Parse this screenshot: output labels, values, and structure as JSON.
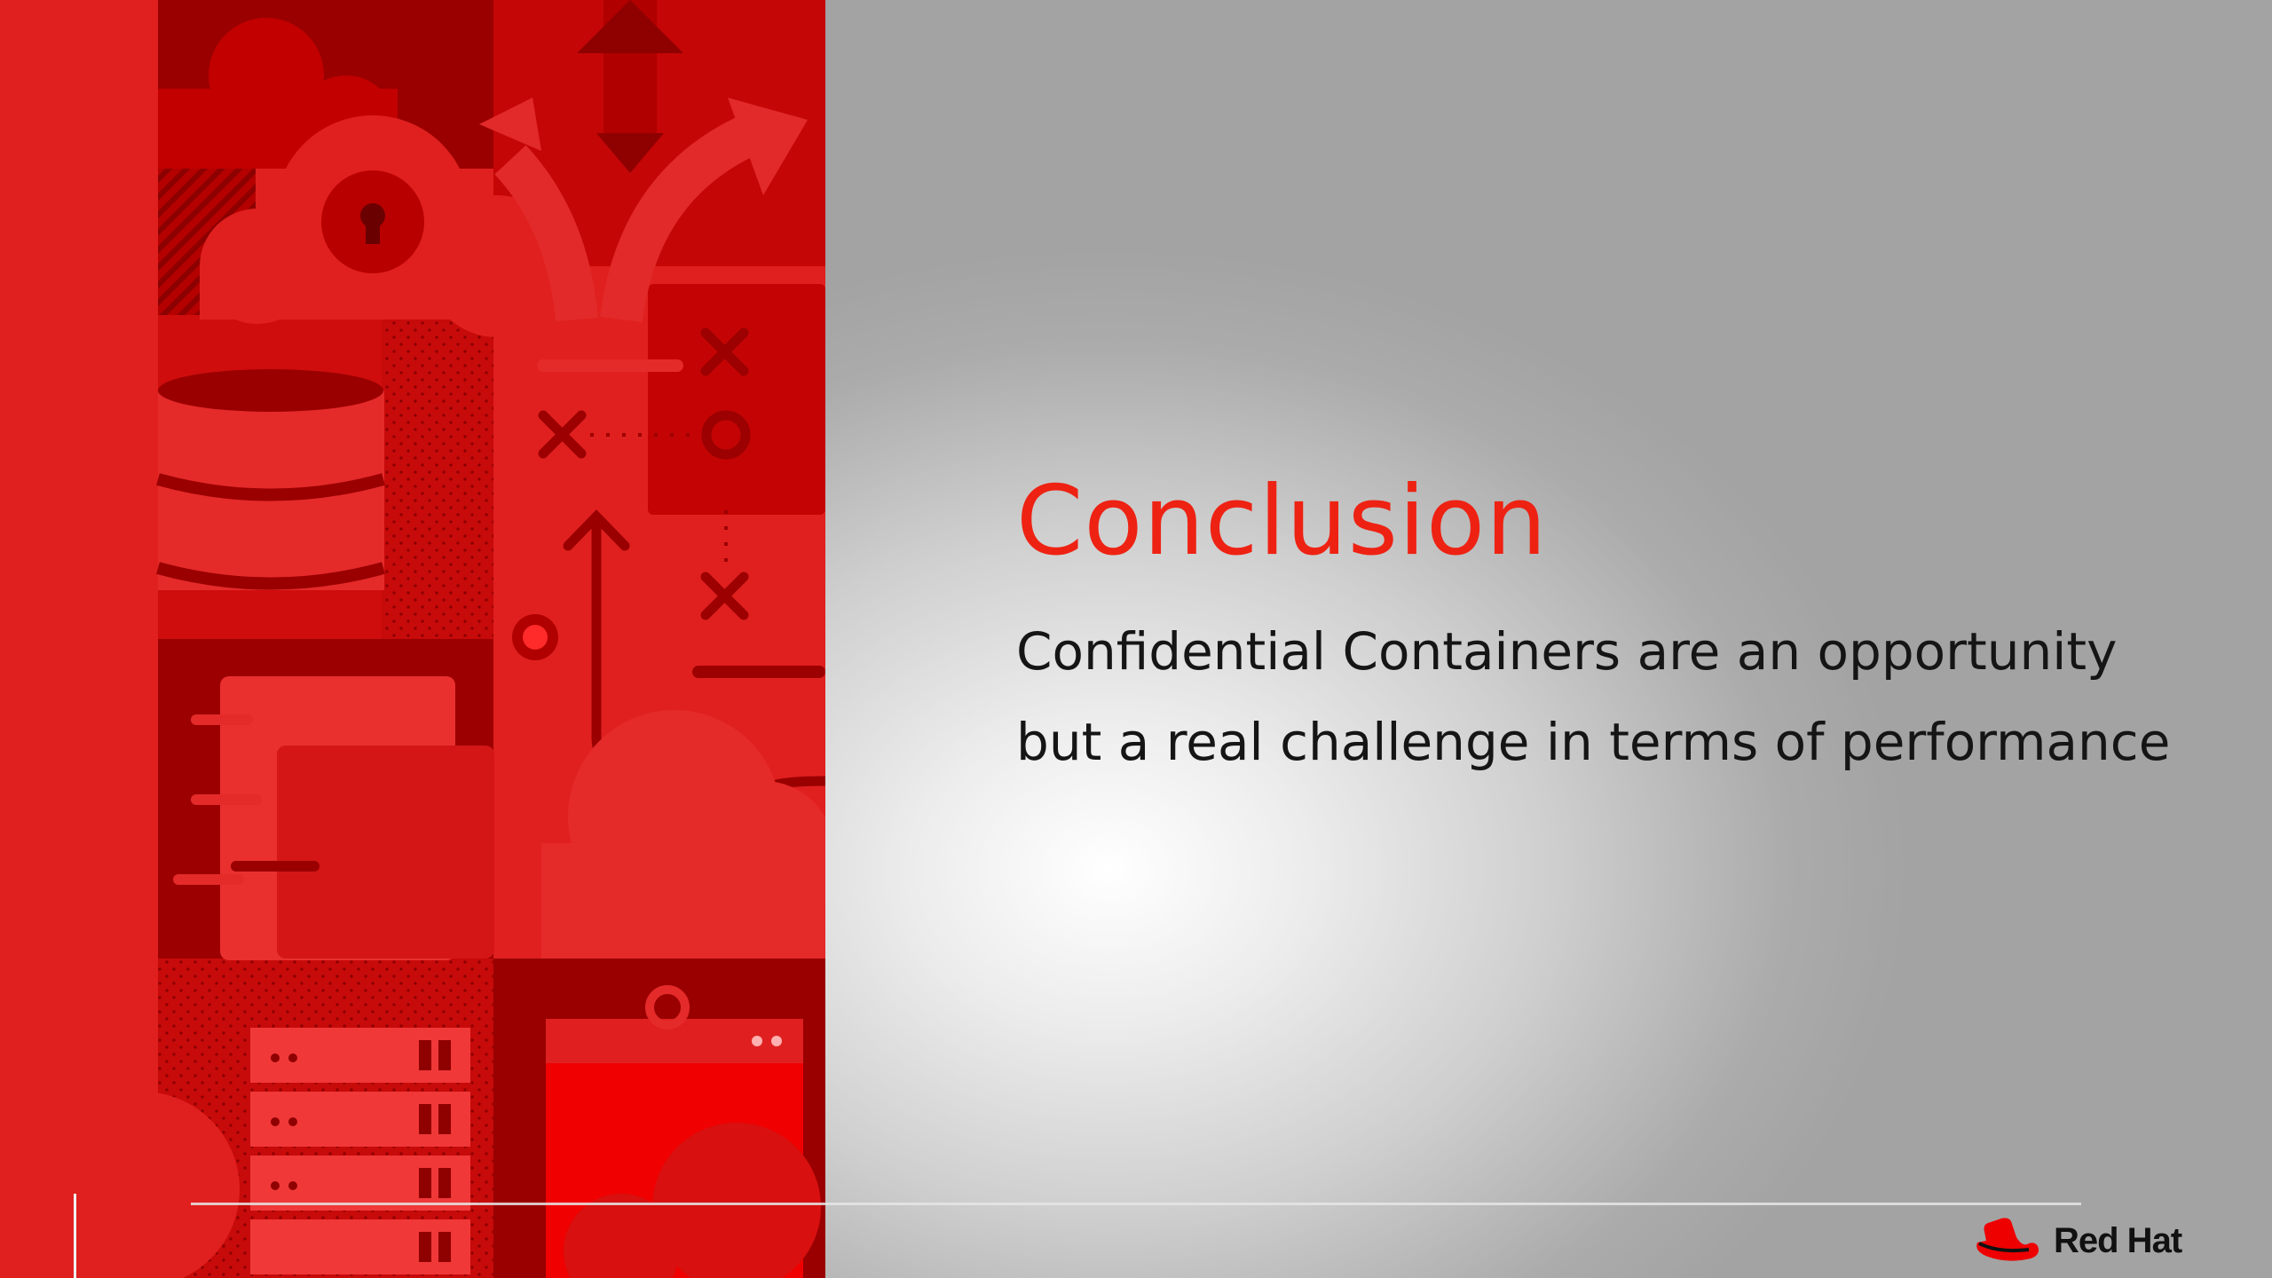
{
  "slide": {
    "title": "Conclusion",
    "body_lines": [
      "Confidential Containers are an opportunity",
      "but a real challenge in terms of performance"
    ]
  },
  "brand": {
    "name": "Red Hat",
    "logo_icon": "red-hat-fedora-icon",
    "accent_color": "#ee0000",
    "title_color": "#ee2213"
  },
  "illustration": {
    "icons": [
      "cloud-icon",
      "lock-keyhole-icon",
      "database-icon",
      "arrow-up-icon",
      "arrow-down-icon",
      "fork-arrows-icon",
      "x-mark-icon",
      "circle-icon",
      "server-rack-icon",
      "browser-window-icon"
    ]
  }
}
